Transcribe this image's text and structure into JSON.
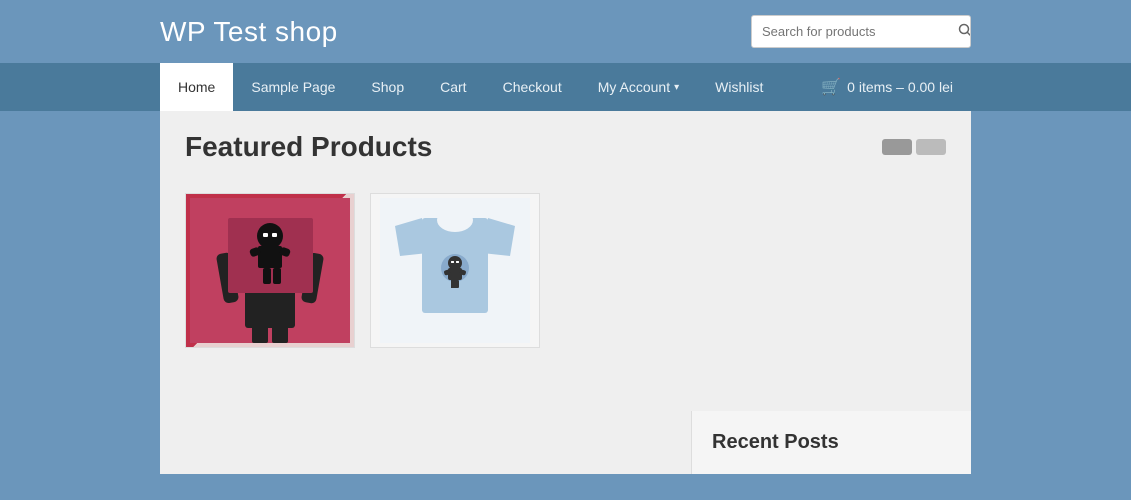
{
  "header": {
    "site_title": "WP Test shop",
    "search_placeholder": "Search for products"
  },
  "nav": {
    "items": [
      {
        "label": "Home",
        "active": true
      },
      {
        "label": "Sample Page",
        "active": false
      },
      {
        "label": "Shop",
        "active": false
      },
      {
        "label": "Cart",
        "active": false
      },
      {
        "label": "Checkout",
        "active": false
      },
      {
        "label": "My Account",
        "active": false,
        "has_dropdown": true
      },
      {
        "label": "Wishlist",
        "active": false
      }
    ],
    "cart_label": "0 items – 0.00 lei"
  },
  "main": {
    "featured_title": "Featured Products",
    "products": [
      {
        "id": 1,
        "type": "ninja-poster"
      },
      {
        "id": 2,
        "type": "tshirt"
      }
    ]
  },
  "sidebar": {
    "title": "Recent Posts"
  }
}
